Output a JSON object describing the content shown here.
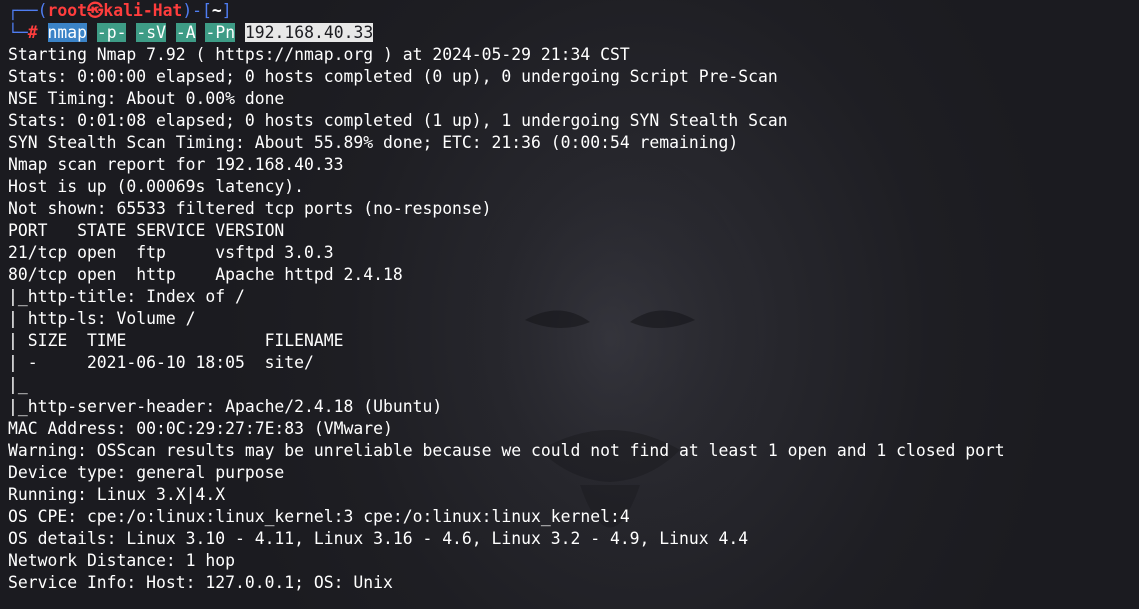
{
  "window": {
    "colors": {
      "background": "#1e1e23",
      "text": "#ffffff",
      "prompt_frame": "#4f7df2",
      "prompt_user": "#ff3d3d",
      "cmd_highlight": "#3b83c7",
      "flag_highlight": "#3e9c86",
      "arg_highlight": "#e8e8e8"
    }
  },
  "prompt": {
    "frame_top": "┌──(",
    "user": "root",
    "at_symbol": "㉿",
    "host": "kali-Hat",
    "mid": ")-[",
    "cwd": "~",
    "end": "]",
    "frame_bottom": "└─",
    "symbol": "#"
  },
  "command": {
    "program": "nmap",
    "flags": [
      "-p-",
      "-sV",
      "-A",
      "-Pn"
    ],
    "target": "192.168.40.33"
  },
  "output": [
    "Starting Nmap 7.92 ( https://nmap.org ) at 2024-05-29 21:34 CST",
    "Stats: 0:00:00 elapsed; 0 hosts completed (0 up), 0 undergoing Script Pre-Scan",
    "NSE Timing: About 0.00% done",
    "Stats: 0:01:08 elapsed; 0 hosts completed (1 up), 1 undergoing SYN Stealth Scan",
    "SYN Stealth Scan Timing: About 55.89% done; ETC: 21:36 (0:00:54 remaining)",
    "Nmap scan report for 192.168.40.33",
    "Host is up (0.00069s latency).",
    "Not shown: 65533 filtered tcp ports (no-response)",
    "PORT   STATE SERVICE VERSION",
    "21/tcp open  ftp     vsftpd 3.0.3",
    "80/tcp open  http    Apache httpd 2.4.18",
    "|_http-title: Index of /",
    "| http-ls: Volume /",
    "| SIZE  TIME              FILENAME",
    "| -     2021-06-10 18:05  site/",
    "|_",
    "|_http-server-header: Apache/2.4.18 (Ubuntu)",
    "MAC Address: 00:0C:29:27:7E:83 (VMware)",
    "Warning: OSScan results may be unreliable because we could not find at least 1 open and 1 closed port",
    "Device type: general purpose",
    "Running: Linux 3.X|4.X",
    "OS CPE: cpe:/o:linux:linux_kernel:3 cpe:/o:linux:linux_kernel:4",
    "OS details: Linux 3.10 - 4.11, Linux 3.16 - 4.6, Linux 3.2 - 4.9, Linux 4.4",
    "Network Distance: 1 hop",
    "Service Info: Host: 127.0.0.1; OS: Unix"
  ]
}
